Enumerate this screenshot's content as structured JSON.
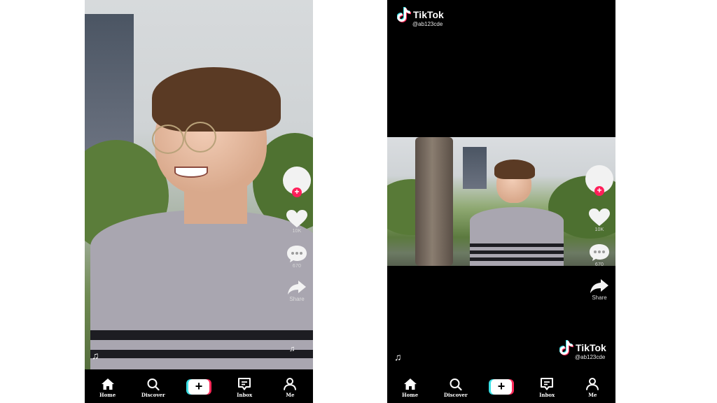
{
  "panels": [
    {
      "sidebar": {
        "like_count": "10K",
        "comment_count": "670",
        "share_label": "Share"
      },
      "music_icon": "music-note-icon"
    },
    {
      "watermark_top": {
        "brand": "TikTok",
        "username": "@ab123cde"
      },
      "sidebar": {
        "like_count": "10K",
        "comment_count": "670",
        "share_label": "Share"
      },
      "watermark_bottom": {
        "brand": "TikTok",
        "username": "@ab123cde"
      },
      "music_icon": "music-note-icon"
    }
  ],
  "nav": {
    "home": "Home",
    "discover": "Discover",
    "inbox": "Inbox",
    "me": "Me"
  },
  "colors": {
    "follow_badge": "#ff1f5a",
    "tiktok_cyan": "#3be0e6",
    "tiktok_red": "#ff2a5a"
  }
}
